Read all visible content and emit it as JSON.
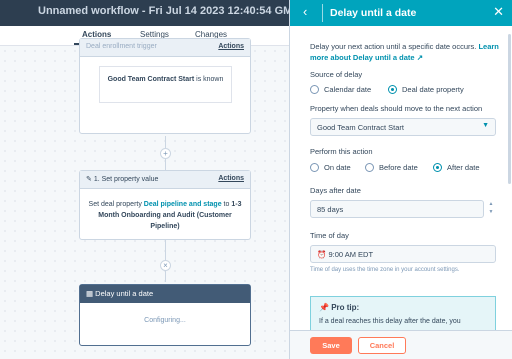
{
  "header": {
    "title": "Unnamed workflow - Fri Jul 14 2023 12:40:54 GMT+0000"
  },
  "tabs": [
    {
      "label": "Actions"
    },
    {
      "label": "Settings"
    },
    {
      "label": "Changes"
    }
  ],
  "trigger_card": {
    "title": "Deal enrollment trigger",
    "actions_label": "Actions",
    "condition_bold": "Good Team Contract Start",
    "condition_rest": " is known"
  },
  "action_card": {
    "title": "1. Set property value",
    "actions_label": "Actions",
    "body_prefix": "Set deal property ",
    "body_link": "Deal pipeline and stage",
    "body_mid": " to ",
    "body_value": "1-3 Month Onboarding and Audit (Customer Pipeline)"
  },
  "delay_card": {
    "title": "Delay until a date",
    "status": "Configuring..."
  },
  "panel": {
    "title": "Delay until a date",
    "description": "Delay your next action until a specific date occurs.",
    "learn_more": "Learn more about Delay until a date",
    "source_label": "Source of delay",
    "source_options": [
      "Calendar date",
      "Deal date property"
    ],
    "source_selected": "Deal date property",
    "property_label": "Property when deals should move to the next action",
    "property_value": "Good Team Contract Start",
    "perform_label": "Perform this action",
    "perform_options": [
      "On date",
      "Before date",
      "After date"
    ],
    "perform_selected": "After date",
    "days_label": "Days after date",
    "days_value": "85 days",
    "time_label": "Time of day",
    "time_value": "9:00 AM EDT",
    "time_help": "Time of day uses the time zone in your account settings.",
    "tip_title": "Pro tip:",
    "tip_body": "If a deal reaches this delay after the date, you"
  },
  "footer": {
    "save_label": "Save",
    "cancel_label": "Cancel"
  },
  "colors": {
    "accent": "#00a4bd",
    "save": "#ff7a59",
    "header": "#2d3e50"
  }
}
